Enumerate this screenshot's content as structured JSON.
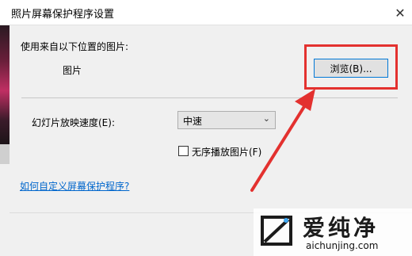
{
  "window": {
    "title": "照片屏幕保护程序设置",
    "close_glyph": "✕"
  },
  "source": {
    "label": "使用来自以下位置的图片:",
    "folder": "图片",
    "browse_label": "浏览(B)..."
  },
  "slideshow": {
    "speed_label": "幻灯片放映速度(E):",
    "speed_value": "中速",
    "shuffle_label": "无序播放图片(F)",
    "shuffle_checked": false
  },
  "help_link": "如何自定义屏幕保护程序?",
  "annotation": {
    "color": "#e3312f"
  },
  "watermark": {
    "name": "爱纯净",
    "url": "aichunjing.com"
  }
}
